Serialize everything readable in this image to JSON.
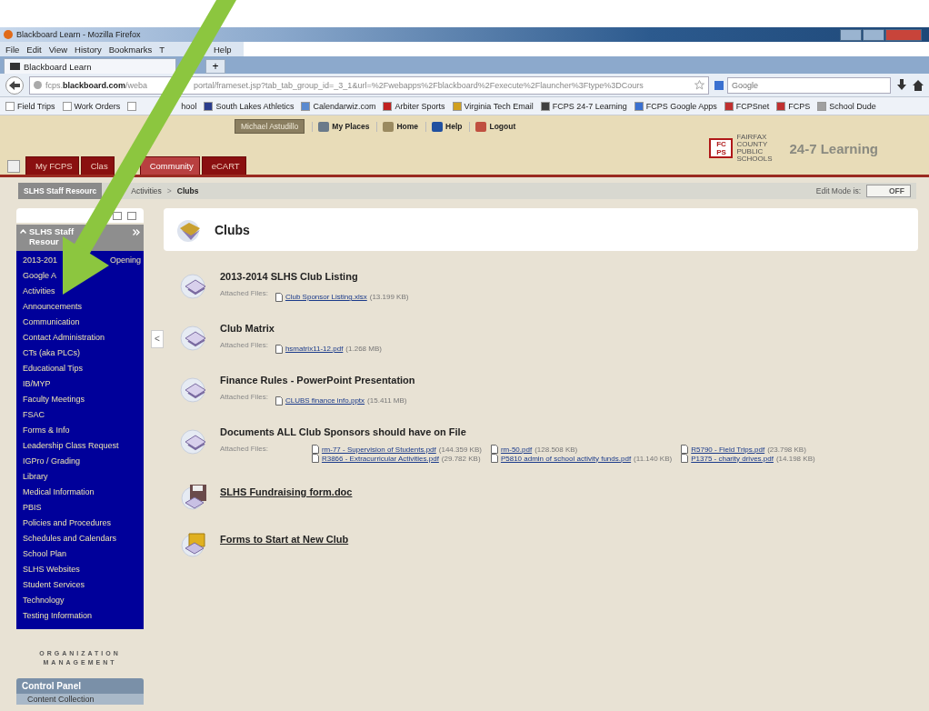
{
  "window": {
    "title": "Blackboard Learn - Mozilla Firefox"
  },
  "menu_bar": [
    "File",
    "Edit",
    "View",
    "History",
    "Bookmarks",
    "T",
    "Help"
  ],
  "browser_tabs": [
    {
      "label": "Blackboard Learn",
      "selected": true
    }
  ],
  "new_tab": "+",
  "address_bar": {
    "url_start": "fcps.**blackboard.com**/weba",
    "url_end": "portal/frameset.jsp?tab_tab_group_id=_3_1&url=%2Fwebapps%2Fblackboard%2Fexecute%2Flauncher%3Ftype%3DCours"
  },
  "search": {
    "placeholder": "Google"
  },
  "bookmarks": [
    {
      "label": "Field Trips",
      "kind": "page"
    },
    {
      "label": "Work Orders",
      "kind": "page"
    },
    {
      "label": "hool",
      "kind": "page"
    },
    {
      "label": "South Lakes Athletics",
      "kind": "shield"
    },
    {
      "label": "Calendarwiz.com",
      "kind": "calendar"
    },
    {
      "label": "Arbiter Sports",
      "kind": "logo"
    },
    {
      "label": "Virginia Tech Email",
      "kind": "badge"
    },
    {
      "label": "FCPS 24-7 Learning",
      "kind": "board"
    },
    {
      "label": "FCPS Google Apps",
      "kind": "google"
    },
    {
      "label": "FCPSnet",
      "kind": "net"
    },
    {
      "label": "FCPS",
      "kind": "book"
    },
    {
      "label": "School Dude",
      "kind": "globe"
    }
  ],
  "user_bar": {
    "user": "Michael Astudillo",
    "links": [
      {
        "label": "My Places",
        "kind": "places"
      },
      {
        "label": "Home",
        "kind": "home"
      },
      {
        "label": "Help",
        "kind": "help"
      },
      {
        "label": "Logout",
        "kind": "logout"
      }
    ]
  },
  "logo": {
    "mark": "FC PS",
    "small": "FAIRFAX COUNTY PUBLIC SCHOOLS",
    "name": "24-7 Learning"
  },
  "nav_tabs": [
    {
      "label": "My FCPS",
      "selected": false
    },
    {
      "label": "Clas",
      "selected": false
    },
    {
      "label": "Community",
      "selected": true
    },
    {
      "label": "eCART",
      "selected": false
    }
  ],
  "breadcrumb": {
    "course": "SLHS Staff Resourc",
    "path": [
      "Activities",
      "Clubs"
    ],
    "separator": ">"
  },
  "edit_mode": {
    "label": "Edit Mode is:",
    "value": "OFF"
  },
  "sidebar": {
    "title_lines": [
      "SLHS Staff",
      "Resour"
    ],
    "items": [
      {
        "label": "2013-201",
        "label_end": "Opening"
      },
      {
        "label": "Google A"
      },
      {
        "label": "Activities"
      },
      {
        "label": "Announcements"
      },
      {
        "label": "Communication"
      },
      {
        "label": "Contact Administration"
      },
      {
        "label": "CTs (aka PLCs)"
      },
      {
        "label": "Educational Tips"
      },
      {
        "label": "IB/MYP"
      },
      {
        "label": "Faculty Meetings"
      },
      {
        "label": "FSAC"
      },
      {
        "label": "Forms & Info"
      },
      {
        "label": "Leadership Class Request"
      },
      {
        "label": "IGPro / Grading"
      },
      {
        "label": "Library"
      },
      {
        "label": "Medical Information"
      },
      {
        "label": "PBIS"
      },
      {
        "label": "Policies and Procedures"
      },
      {
        "label": "Schedules and Calendars"
      },
      {
        "label": "School Plan"
      },
      {
        "label": "SLHS Websites"
      },
      {
        "label": "Student Services"
      },
      {
        "label": "Technology"
      },
      {
        "label": "Testing Information"
      }
    ],
    "section_title": "ORGANIZATION MANAGEMENT",
    "control_panel": {
      "title": "Control Panel",
      "items": [
        "Content Collection"
      ]
    }
  },
  "collapse_tab": "<",
  "content": {
    "title": "Clubs",
    "items": [
      {
        "kind": "item",
        "title": "2013-2014 SLHS Club Listing",
        "files_label": "Attached Files:",
        "files": [
          {
            "name": "Club Sponsor Listing.xlsx",
            "size": "(13.199 KB)"
          }
        ]
      },
      {
        "kind": "item",
        "title": "Club Matrix",
        "files_label": "Attached Files:",
        "files": [
          {
            "name": "hsmatrix11-12.pdf",
            "size": "(1.268 MB)"
          }
        ]
      },
      {
        "kind": "item",
        "title": "Finance Rules - PowerPoint Presentation",
        "files_label": "Attached Files:",
        "files": [
          {
            "name": "CLUBS finance info.pptx",
            "size": "(15.411 MB)"
          }
        ]
      },
      {
        "kind": "item",
        "title": "Documents ALL Club Sponsors should have on File",
        "files_label": "Attached Files:",
        "files": [
          {
            "name": "rm-77 - Supervision of Students.pdf",
            "size": "(144.359 KB)"
          },
          {
            "name": "rm-50.pdf",
            "size": "(128.508 KB)"
          },
          {
            "name": "R5790 - Field Trips.pdf",
            "size": "(23.798 KB)"
          },
          {
            "name": "R3866 - Extracurricular Activities.pdf",
            "size": "(29.782 KB)"
          },
          {
            "name": "P5810 admin of school activity funds.pdf",
            "size": "(11.140 KB)"
          },
          {
            "name": "P1375 - charity drives.pdf",
            "size": "(14.198 KB)"
          }
        ]
      },
      {
        "kind": "file",
        "title": "SLHS Fundraising form.doc"
      },
      {
        "kind": "folder",
        "title": "Forms to Start at New Club"
      }
    ]
  }
}
